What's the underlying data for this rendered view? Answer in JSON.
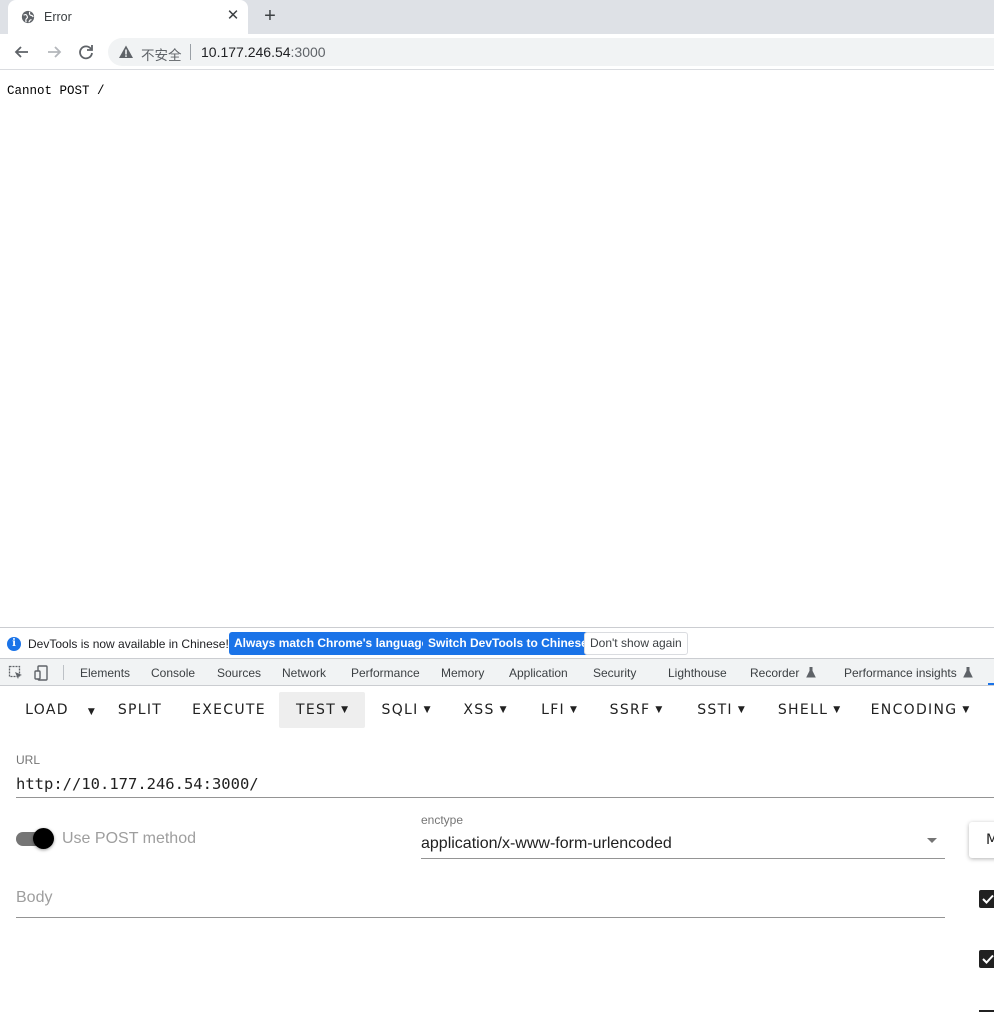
{
  "browser": {
    "tab_title": "Error",
    "tab_close": "✕",
    "new_tab": "+",
    "omnibox": {
      "insecure_label": "不安全",
      "host": "10.177.246.54",
      "port": ":3000"
    },
    "icons": [
      "globe-icon",
      "close-icon",
      "plus-icon",
      "back-arrow-icon",
      "forward-arrow-icon",
      "reload-icon",
      "warning-icon"
    ]
  },
  "page": {
    "body_text": "Cannot POST /"
  },
  "devtools": {
    "infobar": {
      "message": "DevTools is now available in Chinese!",
      "btn_match": "Always match Chrome's language",
      "btn_switch": "Switch DevTools to Chinese",
      "btn_dont_show": "Don't show again"
    },
    "tabs": [
      "Elements",
      "Console",
      "Sources",
      "Network",
      "Performance",
      "Memory",
      "Application",
      "Security",
      "Lighthouse",
      "Recorder",
      "Performance insights"
    ],
    "accent_color": "#1a73e8"
  },
  "hackbar": {
    "menu": {
      "load": "LOAD",
      "split": "SPLIT",
      "execute": "EXECUTE",
      "test": "TEST",
      "sqli": "SQLI",
      "xss": "XSS",
      "lfi": "LFI",
      "ssrf": "SSRF",
      "ssti": "SSTI",
      "shell": "SHELL",
      "encoding": "ENCODING"
    },
    "url_label": "URL",
    "url_value": "http://10.177.246.54:3000/",
    "post_toggle_label": "Use POST method",
    "post_toggle_on": true,
    "enctype_label": "enctype",
    "enctype_value": "application/x-www-form-urlencoded",
    "m_button": "M",
    "body_placeholder": "Body"
  }
}
